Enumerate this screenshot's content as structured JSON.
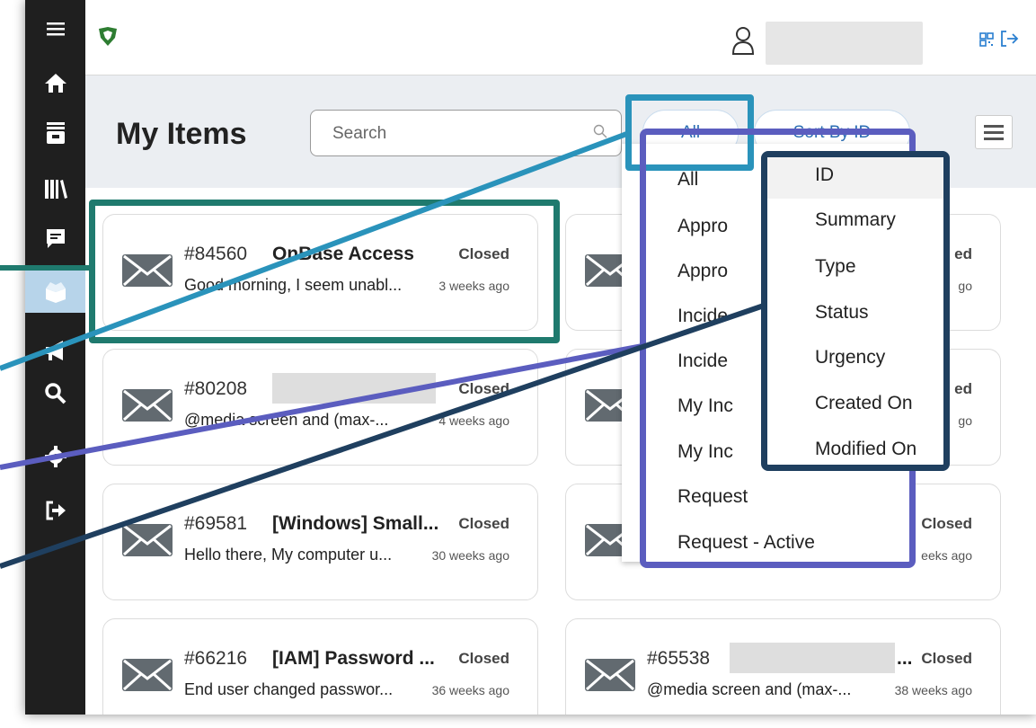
{
  "page_title": "My Items",
  "search": {
    "placeholder": "Search"
  },
  "filter_button": {
    "label": "All"
  },
  "sort_button": {
    "label": "Sort By ID"
  },
  "cards": [
    {
      "id": "#84560",
      "summary": "OnBase Access",
      "status": "Closed",
      "description": "Good morning, I seem unabl...",
      "ago": "3 weeks ago"
    },
    {
      "id": "#80208",
      "summary": "",
      "status": "Closed",
      "description": "@media screen and (max-...",
      "ago": "4 weeks ago"
    },
    {
      "id": "#69581",
      "summary": "[Windows] Small...",
      "status": "Closed",
      "description": "Hello there, My computer u...",
      "ago": "30 weeks ago"
    },
    {
      "id": "#66216",
      "summary": "[IAM] Password ...",
      "status": "Closed",
      "description": "End user changed passwor...",
      "ago": "36 weeks ago"
    },
    {
      "id": "",
      "summary": "",
      "status": "ed",
      "description": "",
      "ago": "go"
    },
    {
      "id": "",
      "summary": "",
      "status": "ed",
      "description": "",
      "ago": "go"
    },
    {
      "id": "",
      "summary": "",
      "status": "Closed",
      "description": "",
      "ago": "eeks ago"
    },
    {
      "id": "#65538",
      "summary": "...",
      "status": "Closed",
      "description": "@media screen and (max-...",
      "ago": "38 weeks ago"
    }
  ],
  "filter_menu": {
    "items": [
      "All",
      "Appro",
      "Appro",
      "Incide",
      "Incide",
      "My Inc",
      "My Inc",
      "Request",
      "Request - Active"
    ]
  },
  "sort_menu": {
    "items": [
      "ID",
      "Summary",
      "Type",
      "Status",
      "Urgency",
      "Created On",
      "Modified On"
    ]
  },
  "colors": {
    "sidebar": "#1f1f1f",
    "sidebar_active": "#b7d4ea",
    "header_band": "#ebeef2",
    "highlight_teal": "#1f7a6e",
    "highlight_blue": "#2a93bb",
    "highlight_purple": "#5b5dbf",
    "highlight_navy": "#1f3f5f"
  },
  "icons": [
    "menu-icon",
    "home-icon",
    "inbox-icon",
    "books-icon",
    "chat-icon",
    "box-icon",
    "megaphone-icon",
    "search-icon",
    "gear-icon",
    "logout-icon",
    "logo-icon",
    "user-icon",
    "qr-icon",
    "envelope-icon"
  ]
}
